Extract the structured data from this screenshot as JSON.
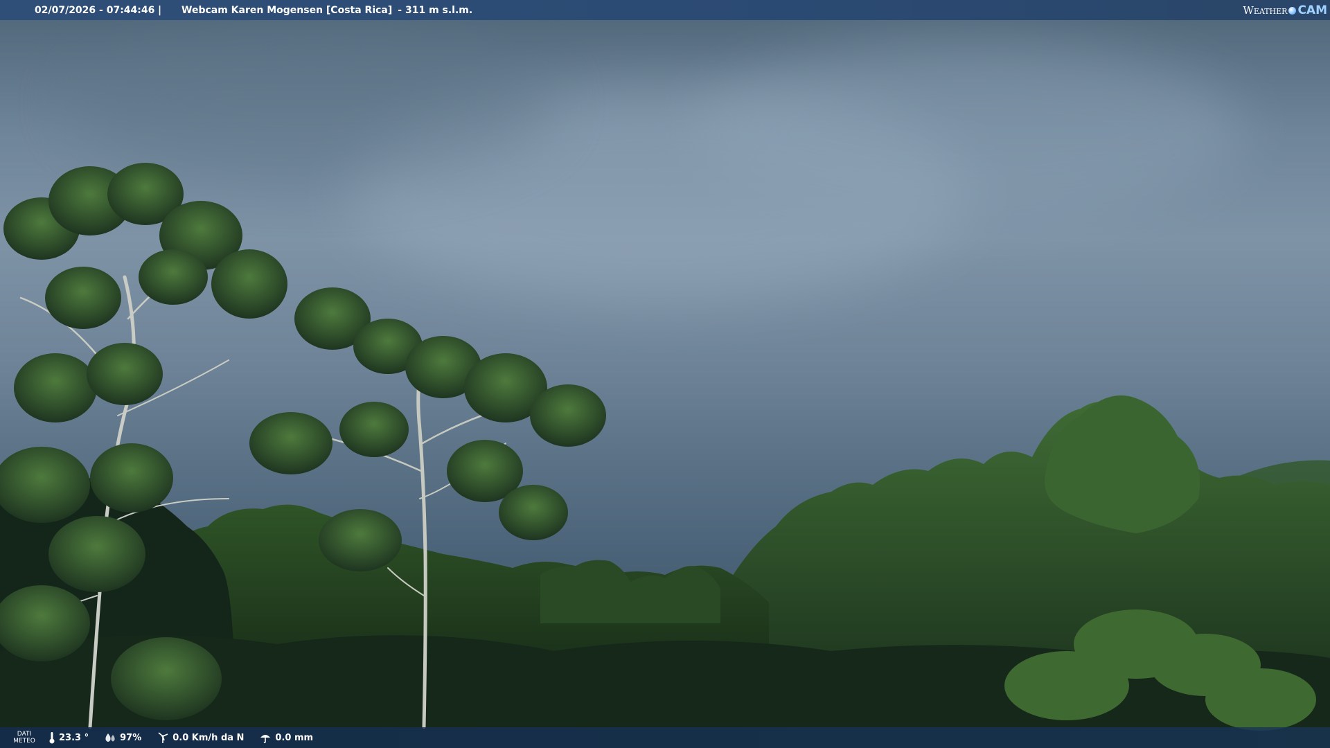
{
  "header": {
    "datetime": "02/07/2026 - 07:44:46",
    "separator": "|",
    "title": "Webcam Karen Mogensen [Costa Rica]",
    "elevation": "- 311 m s.l.m."
  },
  "brand": {
    "part1": "Weather",
    "part2": "CAM"
  },
  "footer": {
    "label_line1": "DATI",
    "label_line2": "METEO",
    "temperature": "23.3 °",
    "humidity": "97%",
    "wind": "0.0 Km/h da N",
    "rain": "0.0 mm"
  },
  "colors": {
    "bar_blue": "#2b4a73",
    "sky": "#7e93a6",
    "foliage": "#1f3a1f"
  },
  "icons": [
    "thermometer-icon",
    "humidity-icon",
    "wind-icon",
    "rain-gauge-icon"
  ]
}
